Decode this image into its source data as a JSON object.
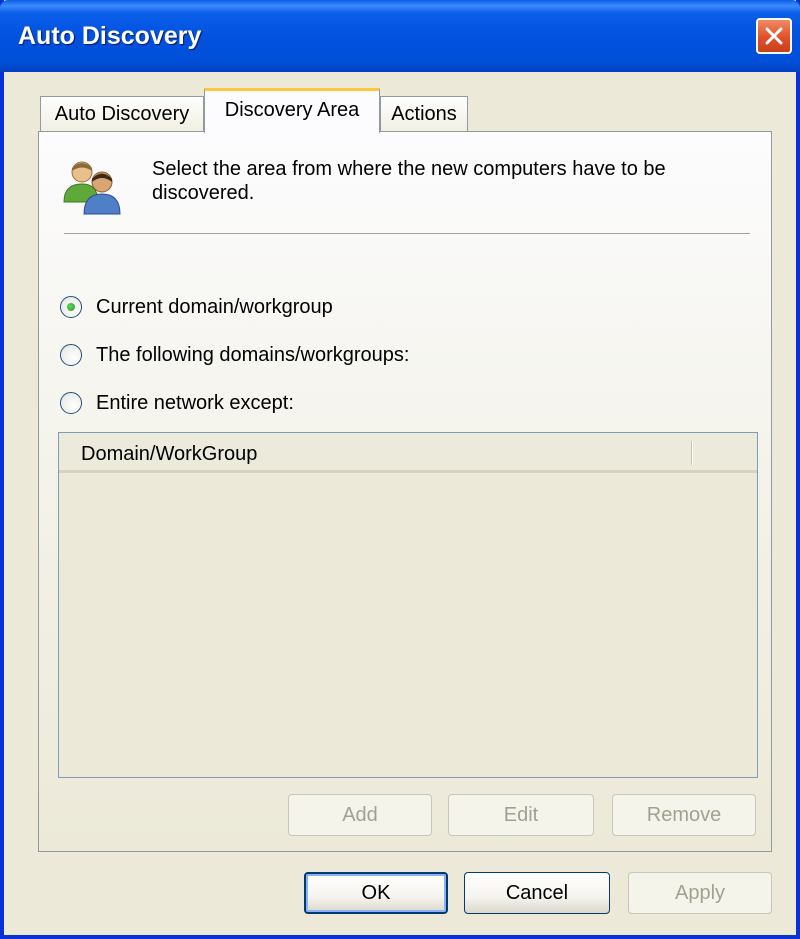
{
  "window": {
    "title": "Auto Discovery"
  },
  "tabs": [
    {
      "label": "Auto Discovery",
      "selected": false
    },
    {
      "label": "Discovery Area",
      "selected": true
    },
    {
      "label": "Actions",
      "selected": false
    }
  ],
  "panel": {
    "icon": "users-icon",
    "description": "Select the area from where the new computers have to be discovered."
  },
  "radios": [
    {
      "label": "Current domain/workgroup",
      "checked": true
    },
    {
      "label": "The following domains/workgroups:",
      "checked": false
    },
    {
      "label": "Entire network except:",
      "checked": false
    }
  ],
  "list": {
    "columns": [
      "Domain/WorkGroup"
    ],
    "rows": []
  },
  "list_buttons": {
    "add": "Add",
    "edit": "Edit",
    "remove": "Remove"
  },
  "dialog_buttons": {
    "ok": "OK",
    "cancel": "Cancel",
    "apply": "Apply"
  },
  "colors": {
    "title_bar": "#0252e0",
    "close_button": "#e2502a",
    "selected_tab_accent": "#ffc83c",
    "radio_dot": "#21a121",
    "dialog_bg": "#ece9d8"
  }
}
